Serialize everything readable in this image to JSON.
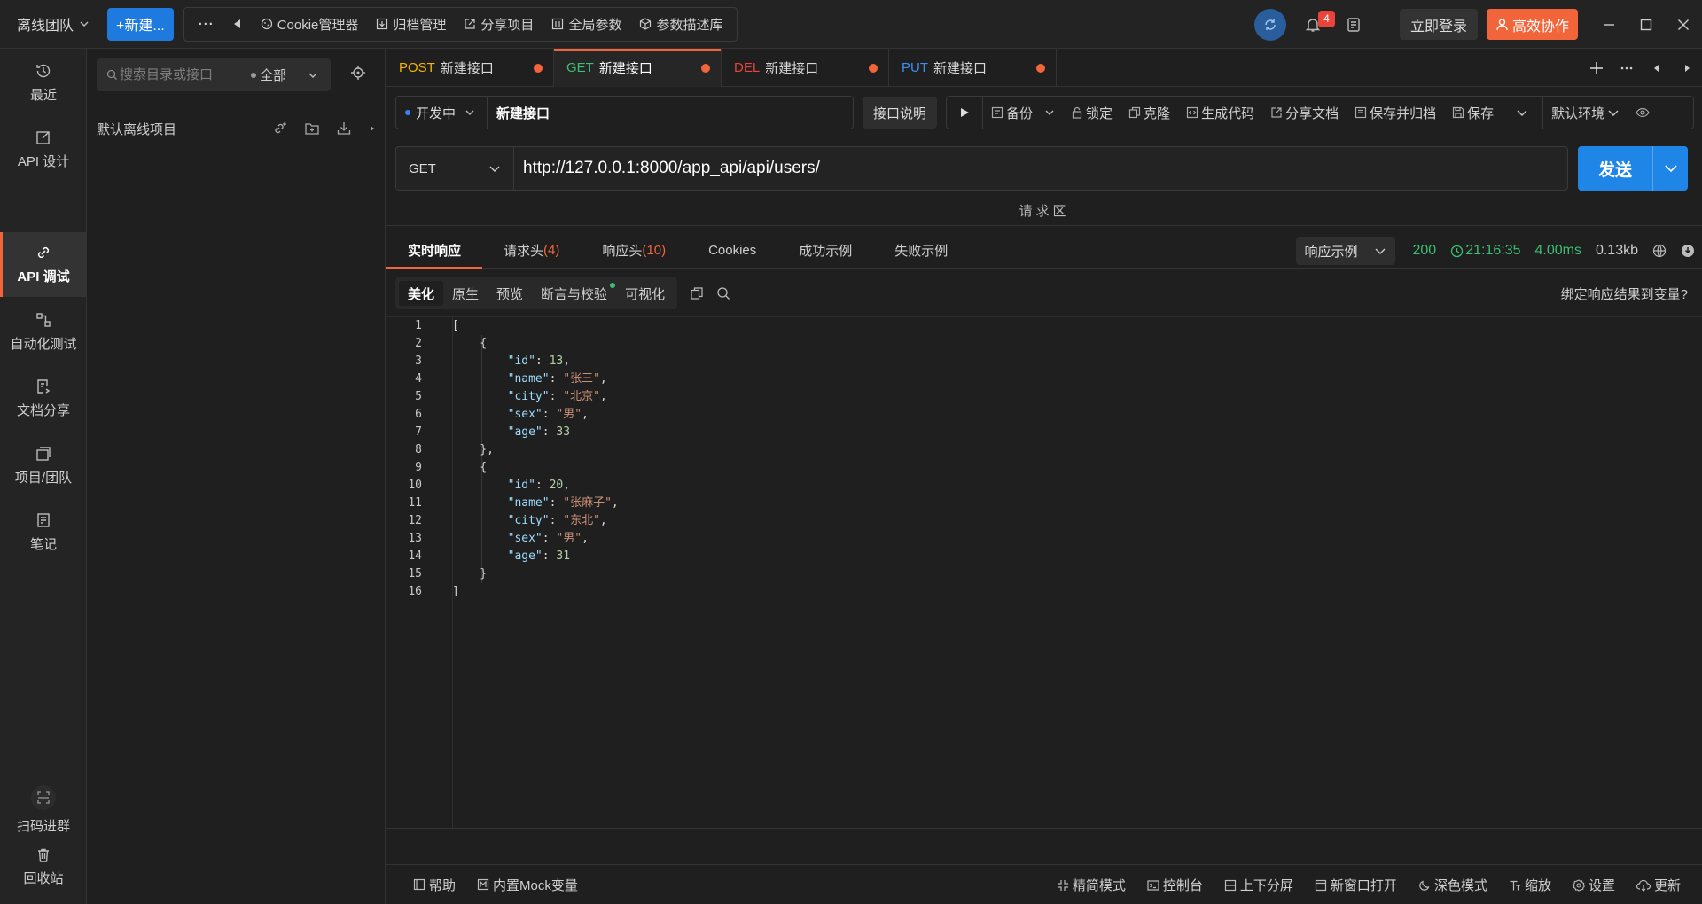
{
  "topbar": {
    "team": "离线团队",
    "new_label": "+新建...",
    "more": "···",
    "tools": [
      "Cookie管理器",
      "归档管理",
      "分享项目",
      "全局参数",
      "参数描述库"
    ],
    "notification_count": "4",
    "login_label": "立即登录",
    "collab_label": "高效协作"
  },
  "leftnav": {
    "items": [
      {
        "label": "最近",
        "icon": "history-icon"
      },
      {
        "label": "API 设计",
        "icon": "edit-icon"
      },
      {
        "label": "API 调试",
        "icon": "link-icon"
      },
      {
        "label": "自动化测试",
        "icon": "flow-icon"
      },
      {
        "label": "文档分享",
        "icon": "doc-share-icon"
      },
      {
        "label": "项目/团队",
        "icon": "project-icon"
      },
      {
        "label": "笔记",
        "icon": "note-icon"
      }
    ],
    "active_index": 2,
    "bottom": [
      {
        "label": "扫码进群",
        "icon": "qrcode-icon"
      },
      {
        "label": "回收站",
        "icon": "trash-icon"
      }
    ]
  },
  "tree": {
    "search_placeholder": "搜索目录或接口",
    "scope": "全部",
    "project_name": "默认离线项目"
  },
  "tabs": [
    {
      "method": "POST",
      "name": "新建接口",
      "color": "#f5b400",
      "active": false
    },
    {
      "method": "GET",
      "name": "新建接口",
      "color": "#3bbf73",
      "active": true
    },
    {
      "method": "DEL",
      "name": "新建接口",
      "color": "#e8443a",
      "active": false
    },
    {
      "method": "PUT",
      "name": "新建接口",
      "color": "#3b8ff0",
      "active": false
    }
  ],
  "infobar": {
    "status": "开发中",
    "api_name": "新建接口",
    "doc_label": "接口说明",
    "actions": [
      "备份",
      "锁定",
      "克隆",
      "生成代码",
      "分享文档",
      "保存并归档",
      "保存"
    ],
    "env": "默认环境"
  },
  "request": {
    "method": "GET",
    "url": "http://127.0.0.1:8000/app_api/api/users/",
    "send_label": "发送",
    "region_label": "请求区"
  },
  "response": {
    "tabs": [
      {
        "label": "实时响应",
        "count": ""
      },
      {
        "label": "请求头",
        "count": "(4)"
      },
      {
        "label": "响应头",
        "count": "(10)"
      },
      {
        "label": "Cookies",
        "count": ""
      },
      {
        "label": "成功示例",
        "count": ""
      },
      {
        "label": "失败示例",
        "count": ""
      }
    ],
    "example_select": "响应示例",
    "status_code": "200",
    "time": "21:16:35",
    "duration": "4.00ms",
    "size": "0.13kb",
    "views": [
      "美化",
      "原生",
      "预览",
      "断言与校验",
      "可视化"
    ],
    "bind_var": "绑定响应结果到变量?"
  },
  "code_lines": [
    [
      {
        "t": "p",
        "v": "["
      }
    ],
    [
      {
        "t": "p",
        "v": "    {"
      }
    ],
    [
      {
        "t": "p",
        "v": "        "
      },
      {
        "t": "k",
        "v": "\"id\""
      },
      {
        "t": "p",
        "v": ": "
      },
      {
        "t": "n",
        "v": "13"
      },
      {
        "t": "p",
        "v": ","
      }
    ],
    [
      {
        "t": "p",
        "v": "        "
      },
      {
        "t": "k",
        "v": "\"name\""
      },
      {
        "t": "p",
        "v": ": "
      },
      {
        "t": "s",
        "v": "\"张三\""
      },
      {
        "t": "p",
        "v": ","
      }
    ],
    [
      {
        "t": "p",
        "v": "        "
      },
      {
        "t": "k",
        "v": "\"city\""
      },
      {
        "t": "p",
        "v": ": "
      },
      {
        "t": "s",
        "v": "\"北京\""
      },
      {
        "t": "p",
        "v": ","
      }
    ],
    [
      {
        "t": "p",
        "v": "        "
      },
      {
        "t": "k",
        "v": "\"sex\""
      },
      {
        "t": "p",
        "v": ": "
      },
      {
        "t": "s",
        "v": "\"男\""
      },
      {
        "t": "p",
        "v": ","
      }
    ],
    [
      {
        "t": "p",
        "v": "        "
      },
      {
        "t": "k",
        "v": "\"age\""
      },
      {
        "t": "p",
        "v": ": "
      },
      {
        "t": "n",
        "v": "33"
      }
    ],
    [
      {
        "t": "p",
        "v": "    },"
      }
    ],
    [
      {
        "t": "p",
        "v": "    {"
      }
    ],
    [
      {
        "t": "p",
        "v": "        "
      },
      {
        "t": "k",
        "v": "\"id\""
      },
      {
        "t": "p",
        "v": ": "
      },
      {
        "t": "n",
        "v": "20"
      },
      {
        "t": "p",
        "v": ","
      }
    ],
    [
      {
        "t": "p",
        "v": "        "
      },
      {
        "t": "k",
        "v": "\"name\""
      },
      {
        "t": "p",
        "v": ": "
      },
      {
        "t": "s",
        "v": "\"张麻子\""
      },
      {
        "t": "p",
        "v": ","
      }
    ],
    [
      {
        "t": "p",
        "v": "        "
      },
      {
        "t": "k",
        "v": "\"city\""
      },
      {
        "t": "p",
        "v": ": "
      },
      {
        "t": "s",
        "v": "\"东北\""
      },
      {
        "t": "p",
        "v": ","
      }
    ],
    [
      {
        "t": "p",
        "v": "        "
      },
      {
        "t": "k",
        "v": "\"sex\""
      },
      {
        "t": "p",
        "v": ": "
      },
      {
        "t": "s",
        "v": "\"男\""
      },
      {
        "t": "p",
        "v": ","
      }
    ],
    [
      {
        "t": "p",
        "v": "        "
      },
      {
        "t": "k",
        "v": "\"age\""
      },
      {
        "t": "p",
        "v": ": "
      },
      {
        "t": "n",
        "v": "31"
      }
    ],
    [
      {
        "t": "p",
        "v": "    }"
      }
    ],
    [
      {
        "t": "p",
        "v": "]"
      }
    ]
  ],
  "footer": {
    "left": [
      "帮助",
      "内置Mock变量"
    ],
    "right": [
      "精简模式",
      "控制台",
      "上下分屏",
      "新窗口打开",
      "深色模式",
      "缩放",
      "设置",
      "更新"
    ]
  },
  "colors": {
    "accent": "#f2653a",
    "primary": "#1f86e8",
    "success": "#3bbf73"
  }
}
